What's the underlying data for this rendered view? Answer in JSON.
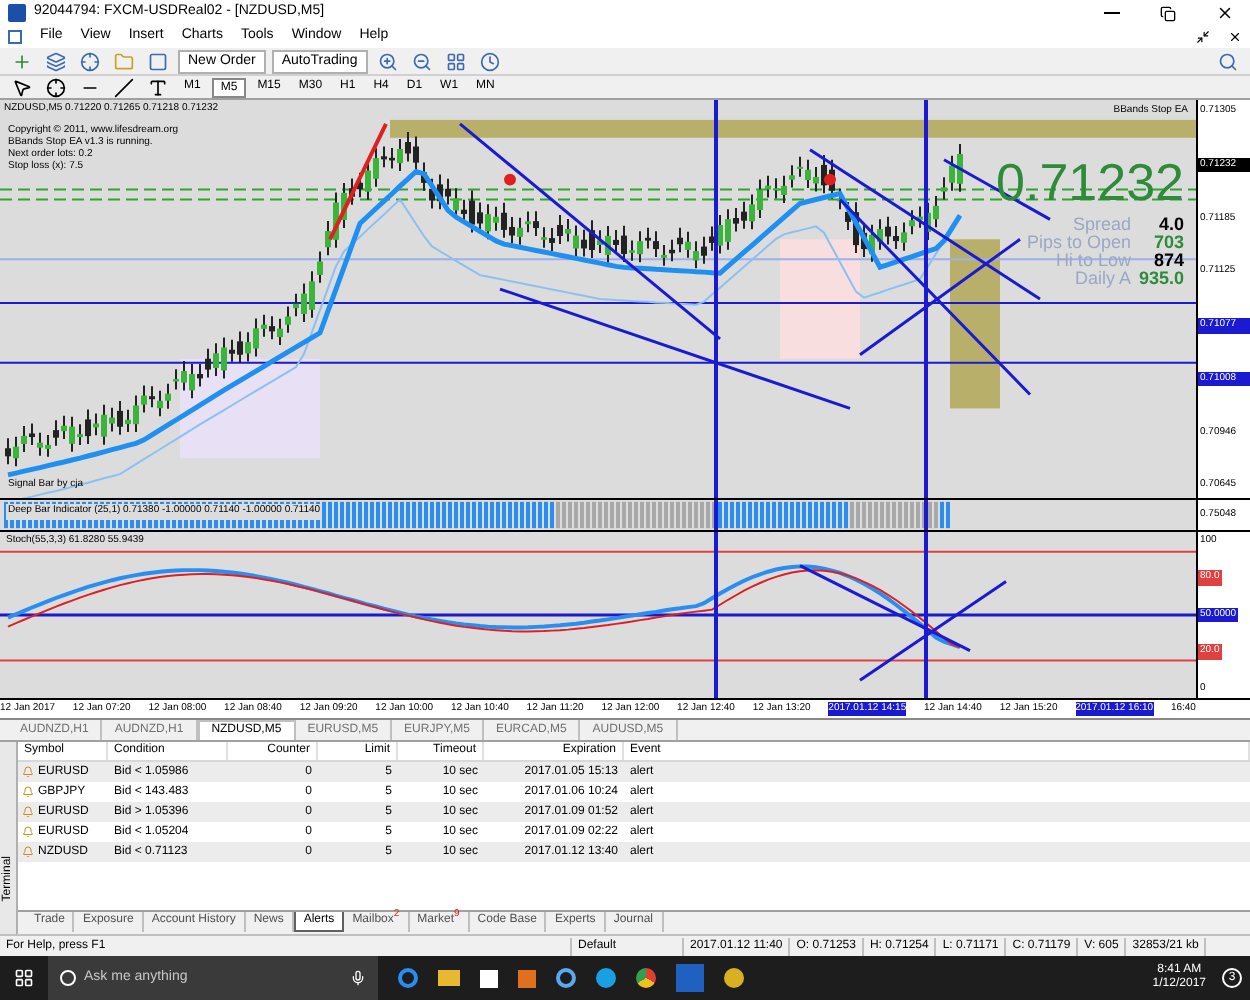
{
  "window": {
    "title": "92044794: FXCM-USDReal02 - [NZDUSD,M5]"
  },
  "menu": [
    "File",
    "View",
    "Insert",
    "Charts",
    "Tools",
    "Window",
    "Help"
  ],
  "toolbar": {
    "buttons": [
      "New Order",
      "AutoTrading"
    ]
  },
  "timeframes": [
    {
      "label": "M1",
      "selected": false
    },
    {
      "label": "M5",
      "selected": true
    },
    {
      "label": "M15",
      "selected": false
    },
    {
      "label": "M30",
      "selected": false
    },
    {
      "label": "H1",
      "selected": false
    },
    {
      "label": "H4",
      "selected": false
    },
    {
      "label": "D1",
      "selected": false
    },
    {
      "label": "W1",
      "selected": false
    },
    {
      "label": "MN",
      "selected": false
    }
  ],
  "chart": {
    "header": "NZDUSD,M5  0.71220 0.71265 0.71218 0.71232",
    "ea_info": [
      "Copyright © 2011, www.lifesdream.org",
      "BBands Stop EA v1.3 is running.",
      "Next order lots: 0.2",
      "Stop loss (x): 7.5"
    ],
    "ea_name": "BBands Stop EA",
    "signal_label": "Signal Bar by cja",
    "price": "0.71232",
    "stats": [
      {
        "label": "Spread",
        "value": "4.0",
        "color": "#000000"
      },
      {
        "label": "Pips to Open",
        "value": "703",
        "color": "#2e8b3a"
      },
      {
        "label": "Hi to Low",
        "value": "874",
        "color": "#000000"
      },
      {
        "label": "Daily A",
        "value": "935.0",
        "color": "#2e8b3a"
      }
    ],
    "price_ticks": [
      {
        "label": "0.71305",
        "kind": "plain"
      },
      {
        "label": "0.71232",
        "kind": "current"
      },
      {
        "label": "0.71185",
        "kind": "plain"
      },
      {
        "label": "0.71125",
        "kind": "plain"
      },
      {
        "label": "0.71077",
        "kind": "line"
      },
      {
        "label": "0.71008",
        "kind": "line"
      },
      {
        "label": "0.70946",
        "kind": "plain"
      },
      {
        "label": "0.70645",
        "kind": "plain"
      }
    ]
  },
  "indicator_bar": {
    "label": "Deep Bar Indicator (25,1) 0.71380 -1.00000 0.71140 -1.00000 0.71140",
    "tick": "0.75048"
  },
  "stochastic": {
    "label": "Stoch(55,3,3) 61.8280 55.9439",
    "ticks": [
      {
        "label": "100",
        "kind": "plain"
      },
      {
        "label": "80.0",
        "kind": "red"
      },
      {
        "label": "50.0000",
        "kind": "blue"
      },
      {
        "label": "20.0",
        "kind": "red"
      },
      {
        "label": "0",
        "kind": "plain"
      }
    ]
  },
  "time_axis": [
    {
      "label": "12 Jan 2017",
      "highlighted": false
    },
    {
      "label": "12 Jan 07:20",
      "highlighted": false
    },
    {
      "label": "12 Jan 08:00",
      "highlighted": false
    },
    {
      "label": "12 Jan 08:40",
      "highlighted": false
    },
    {
      "label": "12 Jan 09:20",
      "highlighted": false
    },
    {
      "label": "12 Jan 10:00",
      "highlighted": false
    },
    {
      "label": "12 Jan 10:40",
      "highlighted": false
    },
    {
      "label": "12 Jan 11:20",
      "highlighted": false
    },
    {
      "label": "12 Jan 12:00",
      "highlighted": false
    },
    {
      "label": "12 Jan 12:40",
      "highlighted": false
    },
    {
      "label": "12 Jan 13:20",
      "highlighted": false
    },
    {
      "label": "2017.01.12 14:15",
      "highlighted": true
    },
    {
      "label": "12 Jan 14:40",
      "highlighted": false
    },
    {
      "label": "12 Jan 15:20",
      "highlighted": false
    },
    {
      "label": "2017.01.12 16:10",
      "highlighted": true
    },
    {
      "label": "16:40",
      "highlighted": false
    }
  ],
  "chart_tabs": [
    {
      "label": "AUDNZD,H1",
      "selected": false
    },
    {
      "label": "AUDNZD,H1",
      "selected": false
    },
    {
      "label": "NZDUSD,M5",
      "selected": true
    },
    {
      "label": "EURUSD,M5",
      "selected": false
    },
    {
      "label": "EURJPY,M5",
      "selected": false
    },
    {
      "label": "EURCAD,M5",
      "selected": false
    },
    {
      "label": "AUDUSD,M5",
      "selected": false
    }
  ],
  "alerts": {
    "columns": [
      "Symbol",
      "Condition",
      "Counter",
      "Limit",
      "Timeout",
      "Expiration",
      "Event"
    ],
    "rows": [
      [
        "EURUSD",
        "Bid < 1.05986",
        "0",
        "5",
        "10 sec",
        "2017.01.05 15:13",
        "alert"
      ],
      [
        "GBPJPY",
        "Bid < 143.483",
        "0",
        "5",
        "10 sec",
        "2017.01.06 10:24",
        "alert"
      ],
      [
        "EURUSD",
        "Bid > 1.05396",
        "0",
        "5",
        "10 sec",
        "2017.01.09 01:52",
        "alert"
      ],
      [
        "EURUSD",
        "Bid < 1.05204",
        "0",
        "5",
        "10 sec",
        "2017.01.09 02:22",
        "alert"
      ],
      [
        "NZDUSD",
        "Bid < 0.71123",
        "0",
        "5",
        "10 sec",
        "2017.01.12 13:40",
        "alert"
      ]
    ]
  },
  "terminal": {
    "side_label": "Terminal",
    "tabs": [
      {
        "label": "Trade",
        "selected": false
      },
      {
        "label": "Exposure",
        "selected": false
      },
      {
        "label": "Account History",
        "selected": false
      },
      {
        "label": "News",
        "selected": false
      },
      {
        "label": "Alerts",
        "selected": true
      },
      {
        "label": "Mailbox",
        "badge": "2",
        "selected": false
      },
      {
        "label": "Market",
        "badge": "9",
        "selected": false
      },
      {
        "label": "Code Base",
        "selected": false
      },
      {
        "label": "Experts",
        "selected": false
      },
      {
        "label": "Journal",
        "selected": false
      }
    ]
  },
  "status_bar": [
    "For Help, press F1",
    "Default",
    "2017.01.12 11:40",
    "O: 0.71253",
    "H: 0.71254",
    "L: 0.71171",
    "C: 0.71179",
    "V: 605",
    "32853/21 kb"
  ],
  "taskbar": {
    "search": {
      "placeholder": "Ask me anything"
    },
    "time": "8:41 AM",
    "date": "1/12/2017",
    "notifications": "3"
  }
}
